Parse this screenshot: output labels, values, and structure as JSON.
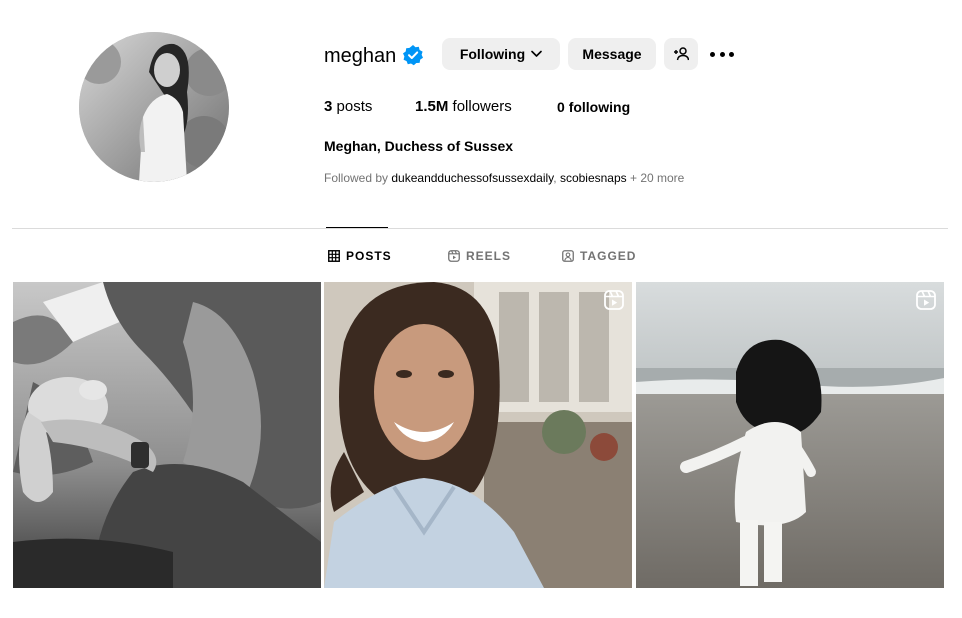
{
  "profile": {
    "username": "meghan",
    "full_name": "Meghan, Duchess of Sussex",
    "verified_icon": "verified-badge-icon",
    "accent_color": "#0095f6"
  },
  "actions": {
    "following_label": "Following",
    "message_label": "Message",
    "add_user_icon": "add-user-icon",
    "more_icon": "more-options-icon"
  },
  "stats": {
    "posts_count": "3",
    "posts_label": "posts",
    "followers_count": "1.5M",
    "followers_label": "followers",
    "following_count": "0",
    "following_label": "following"
  },
  "followed_by": {
    "prefix": "Followed by ",
    "account_1": "dukeandduchessofsussexdaily",
    "separator": ", ",
    "account_2": "scobiesnaps",
    "more": " + 20 more"
  },
  "tabs": [
    {
      "label": "POSTS",
      "icon": "grid-icon",
      "active": true
    },
    {
      "label": "REELS",
      "icon": "reels-icon",
      "active": false
    },
    {
      "label": "TAGGED",
      "icon": "tagged-icon",
      "active": false
    }
  ],
  "posts": [
    {
      "type": "image",
      "reel": false
    },
    {
      "type": "reel",
      "reel": true
    },
    {
      "type": "reel",
      "reel": true
    }
  ]
}
